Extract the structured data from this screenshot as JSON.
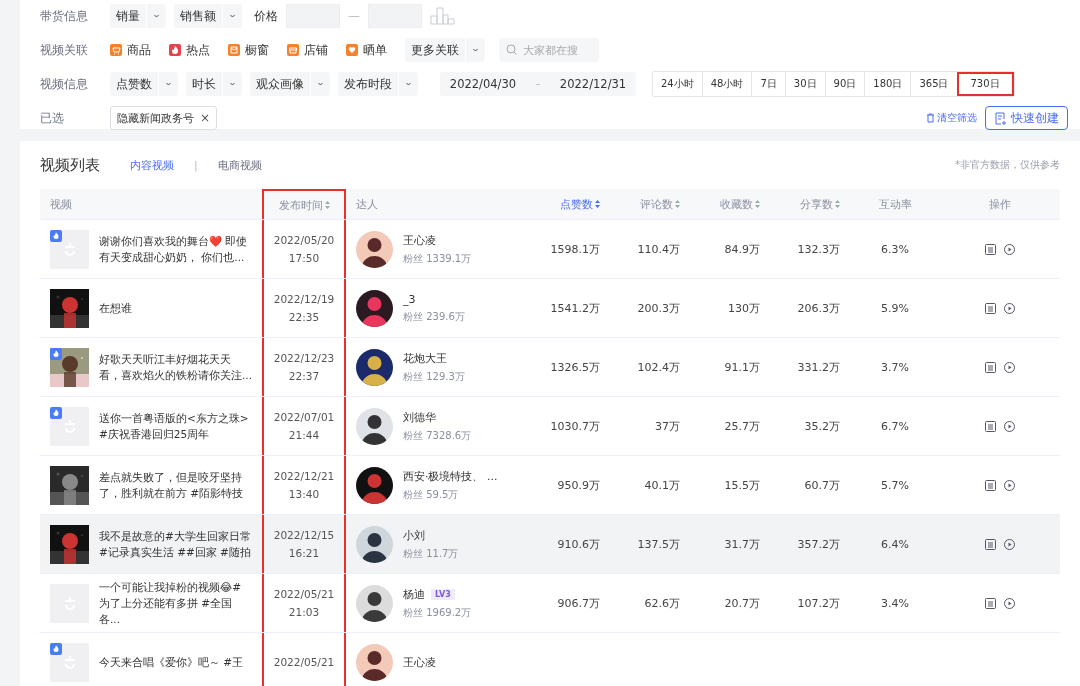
{
  "filters": {
    "sales_row": {
      "label": "带货信息",
      "dropdowns": [
        "销量",
        "销售额"
      ],
      "price_label": "价格",
      "price_separator": "—"
    },
    "relation_row": {
      "label": "视频关联",
      "chips": [
        {
          "label": "商品",
          "kind": "cart",
          "color": "#f5812b"
        },
        {
          "label": "热点",
          "kind": "flame",
          "color": "#e8414b"
        },
        {
          "label": "橱窗",
          "kind": "window",
          "color": "#f5812b"
        },
        {
          "label": "店铺",
          "kind": "store",
          "color": "#f5812b"
        },
        {
          "label": "晒单",
          "kind": "heart",
          "color": "#f5812b"
        }
      ],
      "more_dropdown": "更多关联",
      "search": {
        "placeholder": "大家都在搜"
      }
    },
    "video_row": {
      "label": "视频信息",
      "dropdowns": [
        "点赞数",
        "时长",
        "观众画像",
        "发布时段"
      ],
      "date_start": "2022/04/30",
      "date_separator": "-",
      "date_end": "2022/12/31",
      "ranges": [
        {
          "label": "24小时",
          "highlighted": false
        },
        {
          "label": "48小时",
          "highlighted": false
        },
        {
          "label": "7日",
          "highlighted": false
        },
        {
          "label": "30日",
          "highlighted": false
        },
        {
          "label": "90日",
          "highlighted": false
        },
        {
          "label": "180日",
          "highlighted": false
        },
        {
          "label": "365日",
          "highlighted": false
        },
        {
          "label": "730日",
          "highlighted": true
        }
      ]
    },
    "selected_row": {
      "label": "已选",
      "tags": [
        "隐藏新闻政务号"
      ],
      "tag_close": "×",
      "clear_link": "清空筛选",
      "create_button": "快速创建"
    }
  },
  "video_list": {
    "title": "视频列表",
    "tabs": [
      {
        "label": "内容视频",
        "selected": true
      },
      {
        "label": "电商视频",
        "selected": false
      }
    ],
    "tab_divider": "|",
    "note": "*非官方数据，仅供参考",
    "columns": [
      {
        "label": "视频",
        "sortable": false,
        "sorted": false,
        "highlighted": false
      },
      {
        "label": "发布时间",
        "sortable": true,
        "sorted": false,
        "highlighted": true
      },
      {
        "label": "达人",
        "sortable": false,
        "sorted": false,
        "highlighted": false
      },
      {
        "label": "点赞数",
        "sortable": true,
        "sorted": true,
        "highlighted": false
      },
      {
        "label": "评论数",
        "sortable": true,
        "sorted": false,
        "highlighted": false
      },
      {
        "label": "收藏数",
        "sortable": true,
        "sorted": false,
        "highlighted": false
      },
      {
        "label": "分享数",
        "sortable": true,
        "sorted": false,
        "highlighted": false
      },
      {
        "label": "互动率",
        "sortable": false,
        "sorted": false,
        "highlighted": false
      },
      {
        "label": "操作",
        "sortable": false,
        "sorted": false,
        "highlighted": false
      }
    ],
    "rows": [
      {
        "thumbnail": {
          "kind": "placeholder"
        },
        "hot": true,
        "title": "谢谢你们喜欢我的舞台❤️ 即使有天变成甜心奶奶， 你们也...",
        "date": "2022/05/20",
        "time": "17:50",
        "creator": "王心凌",
        "badge": null,
        "fans": "粉丝 1339.1万",
        "likes": "1598.1万",
        "comments": "110.4万",
        "favorites": "84.9万",
        "shares": "132.3万",
        "rate": "6.3%",
        "hovered": false
      },
      {
        "hot": false,
        "title": "在想谁",
        "date": "2022/12/19",
        "time": "22:35",
        "creator": "_3",
        "badge": null,
        "fans": "粉丝 239.6万",
        "likes": "1541.2万",
        "comments": "200.3万",
        "favorites": "130万",
        "shares": "206.3万",
        "rate": "5.9%",
        "hovered": false
      },
      {
        "hot": true,
        "title": "好歌天天听江丰好烟花天天看，喜欢焰火的铁粉请你关注...",
        "date": "2022/12/23",
        "time": "22:37",
        "creator": "花炮大王",
        "badge": null,
        "fans": "粉丝 129.3万",
        "likes": "1326.5万",
        "comments": "102.4万",
        "favorites": "91.1万",
        "shares": "331.2万",
        "rate": "3.7%",
        "hovered": false
      },
      {
        "thumbnail": {
          "kind": "placeholder"
        },
        "hot": true,
        "title": "送你一首粤语版的<东方之珠> #庆祝香港回归25周年",
        "date": "2022/07/01",
        "time": "21:44",
        "creator": "刘德华",
        "badge": null,
        "fans": "粉丝 7328.6万",
        "likes": "1030.7万",
        "comments": "37万",
        "favorites": "25.7万",
        "shares": "35.2万",
        "rate": "6.7%",
        "hovered": false
      },
      {
        "hot": false,
        "title": "差点就失败了，但是咬牙坚持了，胜利就在前方 #陌影特技",
        "date": "2022/12/21",
        "time": "13:40",
        "creator": "西安·极境特技、 ...",
        "badge": null,
        "fans": "粉丝 59.5万",
        "likes": "950.9万",
        "comments": "40.1万",
        "favorites": "15.5万",
        "shares": "60.7万",
        "rate": "5.7%",
        "hovered": false
      },
      {
        "hot": false,
        "title": "我不是故意的#大学生回家日常 #记录真实生活 ##回家 #随拍",
        "date": "2022/12/15",
        "time": "16:21",
        "creator": "小刘",
        "badge": null,
        "fans": "粉丝 11.7万",
        "likes": "910.6万",
        "comments": "137.5万",
        "favorites": "31.7万",
        "shares": "357.2万",
        "rate": "6.4%",
        "hovered": true
      },
      {
        "thumbnail": {
          "kind": "placeholder"
        },
        "hot": false,
        "title": "一个可能让我掉粉的视频😂# 为了上分还能有多拼 #全国各...",
        "date": "2022/05/21",
        "time": "21:03",
        "creator": "杨迪",
        "badge": "LV3",
        "fans": "粉丝 1969.2万",
        "likes": "906.7万",
        "comments": "62.6万",
        "favorites": "20.7万",
        "shares": "107.2万",
        "rate": "3.4%",
        "hovered": false
      },
      {
        "thumbnail": {
          "kind": "placeholder"
        },
        "hot": true,
        "title": "今天来合唱《爱你》吧～ #王",
        "date": "2022/05/21",
        "time": null,
        "creator": "王心凌",
        "badge": null,
        "fans": null,
        "likes": null,
        "comments": null,
        "favorites": null,
        "shares": null,
        "rate": null,
        "hovered": false
      }
    ]
  }
}
